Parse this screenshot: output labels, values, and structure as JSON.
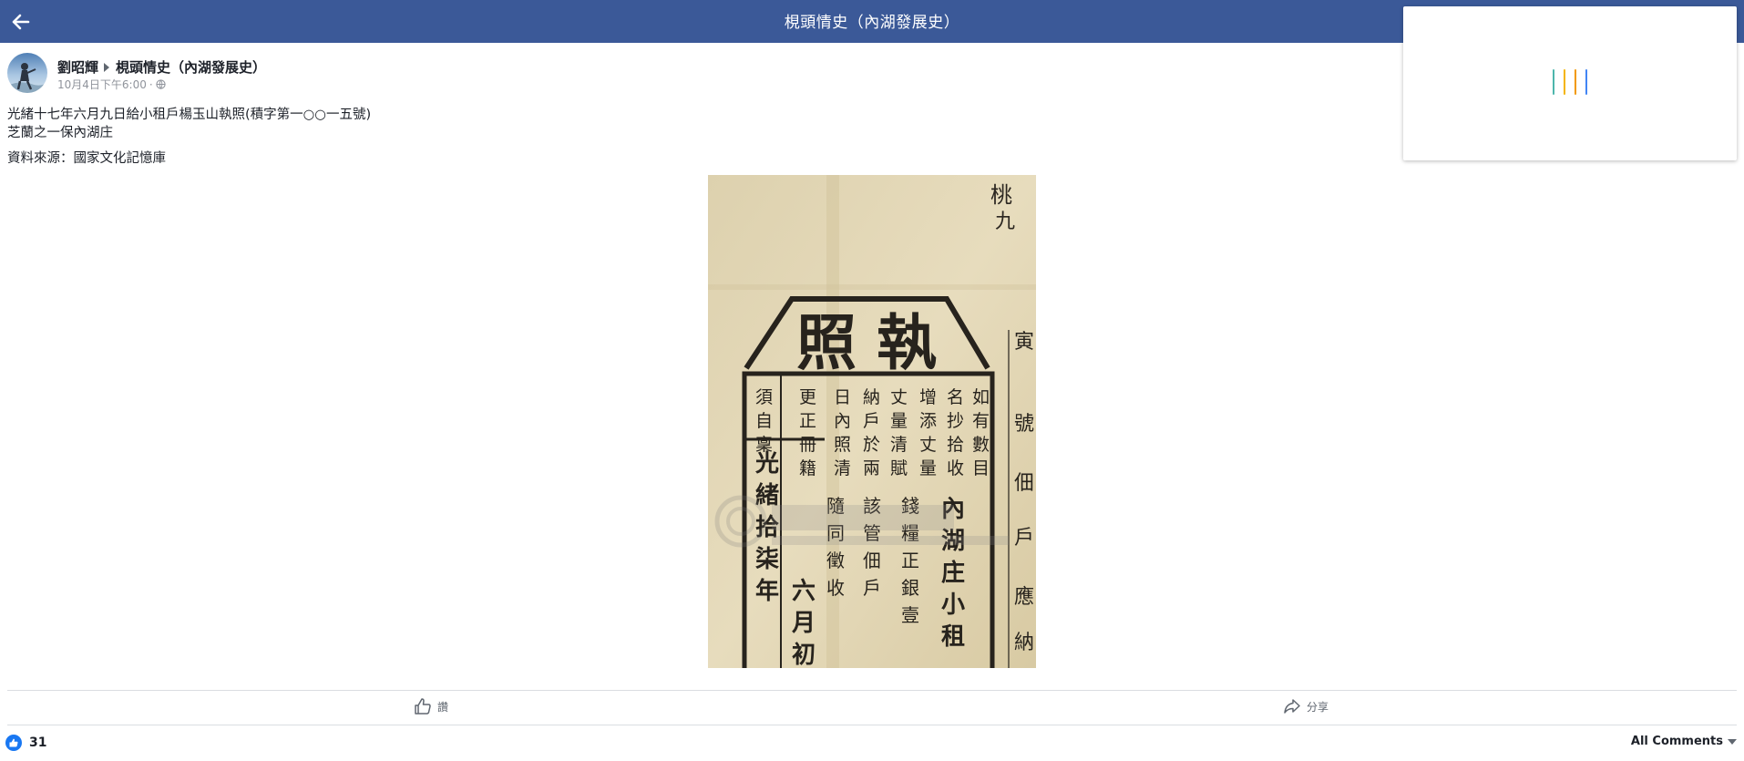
{
  "topbar": {
    "back_icon": "arrow-left-icon",
    "title": "梘頭情史（內湖發展史）"
  },
  "loading_card": {
    "spinner_colors": [
      "#4db6ac",
      "#f4b400",
      "#f29900",
      "#4285f4"
    ]
  },
  "post": {
    "author": "劉昭輝",
    "group": "梘頭情史（內湖發展史）",
    "timestamp": "10月4日下午6:00",
    "audience_icon": "globe-icon",
    "text_lines": [
      "光緒十七年六月九日給小租戶楊玉山執照(積字第一○○一五號)",
      "芝蘭之一保內湖庄"
    ],
    "source": "資料來源：國家文化記憶庫",
    "photo_alt": "執照"
  },
  "actions": {
    "like_label": "讚",
    "share_label": "分享"
  },
  "reactions": {
    "count": "31"
  },
  "comments": {
    "sort_label": "All Comments"
  },
  "colors": {
    "brand": "#3b5998",
    "like_blue": "#1877f2"
  }
}
